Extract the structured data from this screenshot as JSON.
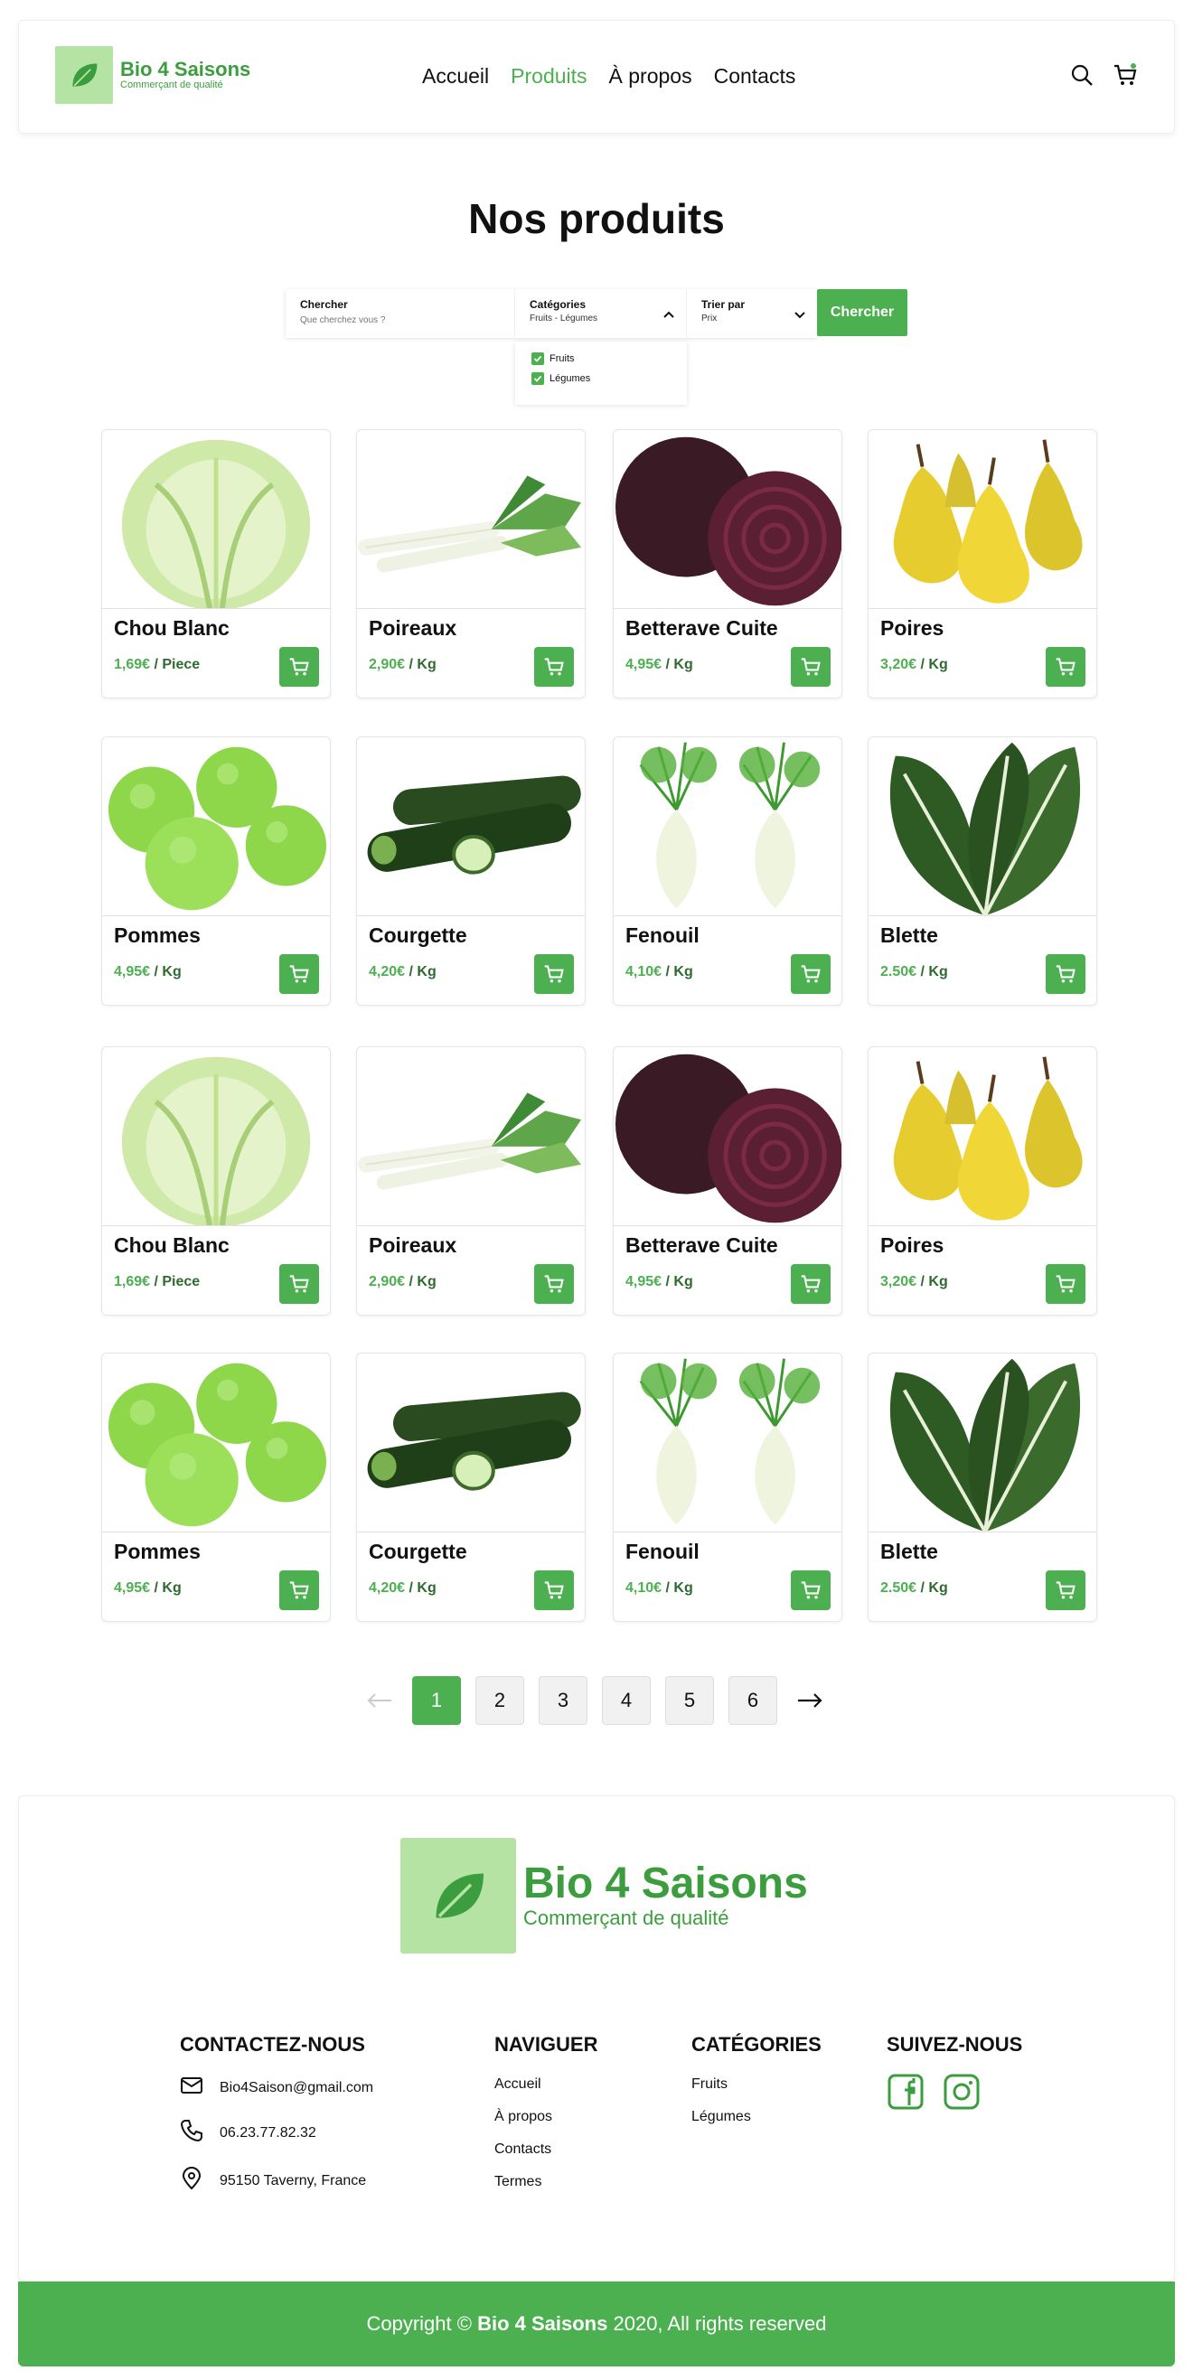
{
  "brand": {
    "name": "Bio 4 Saisons",
    "tagline": "Commerçant de qualité"
  },
  "nav": {
    "items": [
      "Accueil",
      "Produits",
      "À propos",
      "Contacts"
    ],
    "active": "Produits"
  },
  "header_icons": [
    "search-icon",
    "cart-icon"
  ],
  "page": {
    "title": "Nos produits"
  },
  "search": {
    "label": "Chercher",
    "placeholder": "Que cherchez vous ?",
    "categories_label": "Catégories",
    "categories_value": "Fruits - Légumes",
    "sort_label": "Trier par",
    "sort_value": "Prix",
    "button": "Chercher",
    "dropdown_options": [
      "Fruits",
      "Légumes"
    ]
  },
  "products": [
    {
      "name": "Chou Blanc",
      "price": "1,69€",
      "unit": " / Piece",
      "img": "cabbage"
    },
    {
      "name": "Poireaux",
      "price": "2,90€",
      "unit": " / Kg",
      "img": "leek"
    },
    {
      "name": "Betterave Cuite",
      "price": "4,95€",
      "unit": " / Kg",
      "img": "beet"
    },
    {
      "name": "Poires",
      "price": "3,20€",
      "unit": " / Kg",
      "img": "pear"
    },
    {
      "name": "Pommes",
      "price": "4,95€",
      "unit": " / Kg",
      "img": "apple"
    },
    {
      "name": "Courgette",
      "price": "4,20€",
      "unit": " / Kg",
      "img": "zucchini"
    },
    {
      "name": "Fenouil",
      "price": "4,10€",
      "unit": " / Kg",
      "img": "fennel"
    },
    {
      "name": "Blette",
      "price": "2.50€",
      "unit": " / Kg",
      "img": "chard"
    },
    {
      "name": "Chou Blanc",
      "price": "1,69€",
      "unit": " / Piece",
      "img": "cabbage"
    },
    {
      "name": "Poireaux",
      "price": "2,90€",
      "unit": " / Kg",
      "img": "leek"
    },
    {
      "name": "Betterave Cuite",
      "price": "4,95€",
      "unit": " / Kg",
      "img": "beet"
    },
    {
      "name": "Poires",
      "price": "3,20€",
      "unit": " / Kg",
      "img": "pear"
    },
    {
      "name": "Pommes",
      "price": "4,95€",
      "unit": " / Kg",
      "img": "apple"
    },
    {
      "name": "Courgette",
      "price": "4,20€",
      "unit": " / Kg",
      "img": "zucchini"
    },
    {
      "name": "Fenouil",
      "price": "4,10€",
      "unit": " / Kg",
      "img": "fennel"
    },
    {
      "name": "Blette",
      "price": "2.50€",
      "unit": " / Kg",
      "img": "chard"
    }
  ],
  "pagination": {
    "pages": [
      "1",
      "2",
      "3",
      "4",
      "5",
      "6"
    ],
    "current": "1"
  },
  "footer": {
    "contact": {
      "heading": "CONTACTEZ-NOUS",
      "email": "Bio4Saison@gmail.com",
      "phone": "06.23.77.82.32",
      "address": "95150 Taverny, France"
    },
    "navigate": {
      "heading": "NAVIGUER",
      "links": [
        "Accueil",
        "À propos",
        "Contacts",
        "Termes"
      ]
    },
    "categories": {
      "heading": "CATÉGORIES",
      "links": [
        "Fruits",
        "Légumes"
      ]
    },
    "social": {
      "heading": "SUIVEZ-NOUS",
      "icons": [
        "facebook-icon",
        "instagram-icon"
      ]
    },
    "copyright_prefix": "Copyright ©",
    "copyright_brand": "Bio 4 Saisons",
    "copyright_suffix": "2020, All rights reserved"
  },
  "colors": {
    "accent": "#4caf50",
    "brand_dark": "#3b9d3d",
    "logo_bg": "#b5e3a3"
  }
}
